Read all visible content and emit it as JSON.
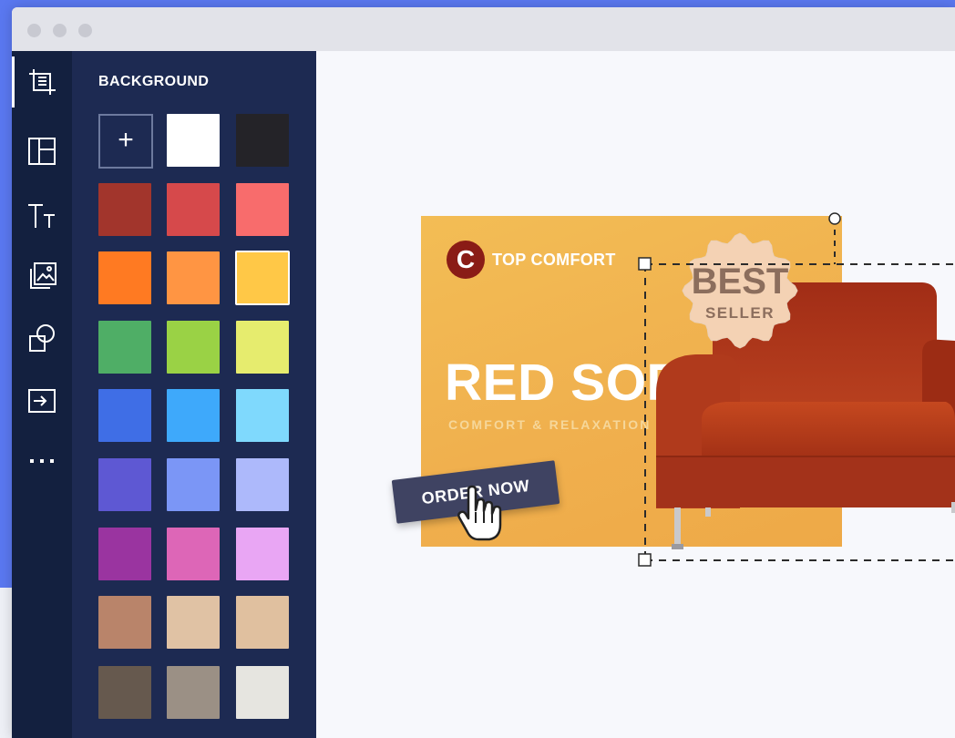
{
  "window": {
    "title_controls": [
      "close",
      "minimize",
      "maximize"
    ]
  },
  "toolbar": {
    "items": [
      {
        "id": "background",
        "icon": "background-tool-icon",
        "active": true
      },
      {
        "id": "layout",
        "icon": "layout-grid-icon",
        "active": false
      },
      {
        "id": "text",
        "icon": "text-icon",
        "active": false
      },
      {
        "id": "images",
        "icon": "images-icon",
        "active": false
      },
      {
        "id": "shapes",
        "icon": "shapes-icon",
        "active": false
      },
      {
        "id": "upload",
        "icon": "import-icon",
        "active": false
      },
      {
        "id": "more",
        "icon": "more-dots-icon",
        "active": false
      }
    ]
  },
  "panel": {
    "title": "BACKGROUND",
    "add_label": "+",
    "selected_color": "#ffc847",
    "swatches": [
      "#ffffff",
      "#242328",
      "#a2352c",
      "#d6494b",
      "#f86c6c",
      "#ff7a22",
      "#ff9543",
      "#ffc847",
      "#4fae66",
      "#9ad245",
      "#e6ec6e",
      "#3f6ee6",
      "#3ea9fb",
      "#7fd9fd",
      "#5e58d3",
      "#7b96f6",
      "#adb9fb",
      "#9a34a0",
      "#dd66b7",
      "#e9a6f4",
      "#b9846a",
      "#e0c2a4",
      "#e0c09f",
      "#66594e",
      "#9b9085",
      "#e6e5e0"
    ]
  },
  "banner": {
    "logo_letter": "C",
    "brand": "TOP COMFORT",
    "headline": "RED SOFA",
    "tagline": "COMFORT & RELAXATION",
    "cta": "ORDER NOW",
    "badge_line1": "BEST",
    "badge_line2": "SELLER",
    "accent_color": "#f0b04e",
    "logo_color": "#8a1c16",
    "sofa_color": "#b43a1f"
  }
}
